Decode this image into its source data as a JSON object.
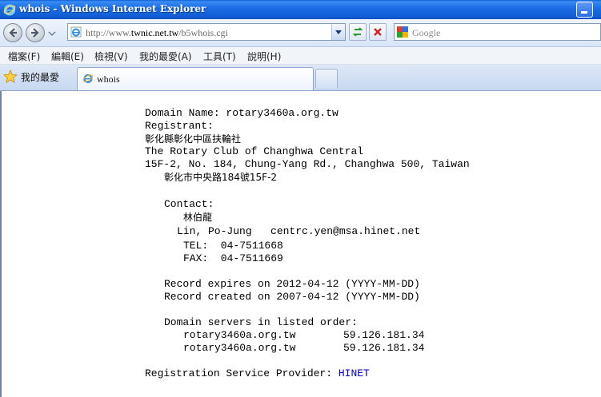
{
  "window": {
    "title": "whois - Windows Internet Explorer"
  },
  "navbar": {
    "address_prefix": "http://www.",
    "address_domain": "twnic.net.tw",
    "address_path": "/b5whois.cgi",
    "search_placeholder": "Google"
  },
  "menubar": {
    "items": [
      "檔案(F)",
      "編輯(E)",
      "檢視(V)",
      "我的最愛(A)",
      "工具(T)",
      "說明(H)"
    ]
  },
  "tabs": {
    "favorites_label": "我的最愛",
    "active_tab_label": "whois"
  },
  "whois": {
    "domain_line": "Domain Name: rotary3460a.org.tw",
    "registrant_label": "Registrant:",
    "registrant_zh": "彰化縣彰化中區扶輪社",
    "registrant_en": "The Rotary Club of Changhwa Central",
    "address_en": "15F-2, No. 184, Chung-Yang Rd., Changhwa 500, Taiwan",
    "address_zh": "彰化市中央路184號15F-2",
    "contact_label": "Contact:",
    "contact_name_zh": "林伯龍",
    "contact_name_email": "Lin, Po-Jung   centrc.yen@msa.hinet.net",
    "tel": "TEL:  04-7511668",
    "fax": "FAX:  04-7511669",
    "expires": "Record expires on 2012-04-12 (YYYY-MM-DD)",
    "created": "Record created on 2007-04-12 (YYYY-MM-DD)",
    "servers_label": "Domain servers in listed order:",
    "servers": [
      {
        "host": "rotary3460a.org.tw",
        "ip": "59.126.181.34"
      },
      {
        "host": "rotary3460a.org.tw",
        "ip": "59.126.181.34"
      }
    ],
    "provider_label": "Registration Service Provider: ",
    "provider_link": "HINET"
  },
  "colors": {
    "titlebar": "#1c6fe6",
    "link": "#0000cc"
  }
}
